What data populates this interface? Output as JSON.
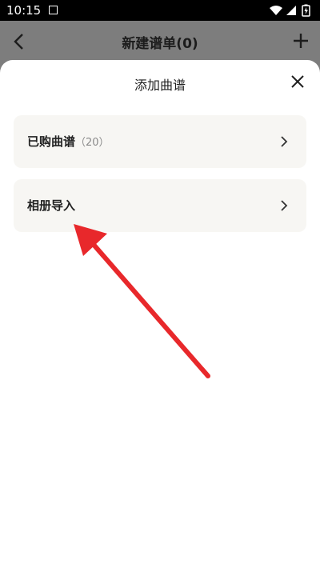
{
  "status_bar": {
    "time": "10:15"
  },
  "background_page": {
    "title": "新建谱单(0)"
  },
  "sheet": {
    "title": "添加曲谱",
    "options": [
      {
        "label": "已购曲谱",
        "count": "（20）"
      },
      {
        "label": "相册导入"
      }
    ]
  },
  "colors": {
    "annotation_arrow": "#e8282b",
    "option_bg": "#f7f6f3",
    "overlay": "#7d7d7d"
  },
  "icons": [
    "back-arrow-icon",
    "plus-icon",
    "close-icon",
    "chevron-right-icon",
    "wifi-icon",
    "signal-icon",
    "battery-icon"
  ]
}
